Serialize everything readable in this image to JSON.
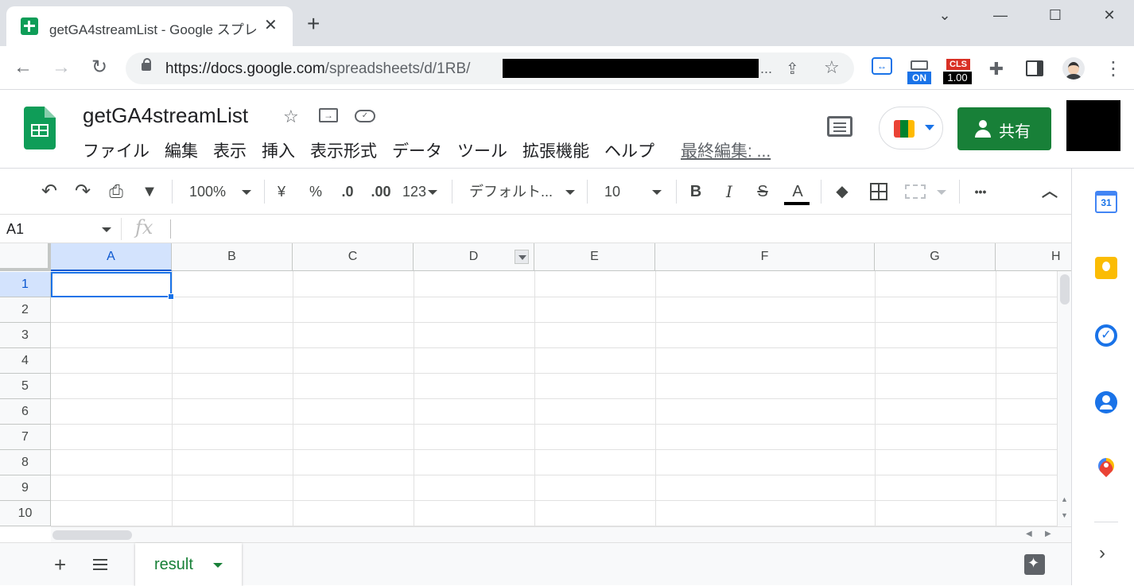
{
  "browser": {
    "tab_title": "getGA4streamList - Google スプレ",
    "tab_close": "✕",
    "new_tab": "+",
    "window_controls": {
      "minimize": "—",
      "maximize": "☐",
      "close": "✕",
      "tab_search": "⌄"
    },
    "url_host": "https://docs.google.com",
    "url_path": "/spreadsheets/d/1RB/",
    "url_ellipsis": "...",
    "extensions": {
      "on_badge": "ON",
      "cls_label": "CLS",
      "cls_value": "1.00"
    },
    "menu": "⋮"
  },
  "doc": {
    "title": "getGA4streamList",
    "menu": [
      "ファイル",
      "編集",
      "表示",
      "挿入",
      "表示形式",
      "データ",
      "ツール",
      "拡張機能",
      "ヘルプ"
    ],
    "last_edit": "最終編集: ...",
    "share_label": "共有"
  },
  "toolbar": {
    "zoom": "100%",
    "currency": "¥",
    "percent": "%",
    "dec_decrease": ".0",
    "dec_increase": ".00",
    "more_formats": "123",
    "font": "デフォルト...",
    "font_size": "10",
    "bold": "B",
    "italic": "I",
    "strike": "S",
    "text_color": "A",
    "more": "•••",
    "collapse": "︿"
  },
  "formula_bar": {
    "name_box": "A1",
    "fx": "fx",
    "value": ""
  },
  "grid": {
    "columns": [
      "A",
      "B",
      "C",
      "D",
      "E",
      "F",
      "G",
      "H"
    ],
    "rows": [
      "1",
      "2",
      "3",
      "4",
      "5",
      "6",
      "7",
      "8",
      "9",
      "10"
    ],
    "selected_cell": "A1"
  },
  "sheets": {
    "add": "+",
    "tabs": [
      {
        "name": "result"
      }
    ]
  },
  "side_panel": {
    "calendar_day": "31",
    "tasks_mark": "✓",
    "expand": "›"
  },
  "colors": {
    "sheets_green": "#188038",
    "selection_blue": "#1a73e8"
  }
}
